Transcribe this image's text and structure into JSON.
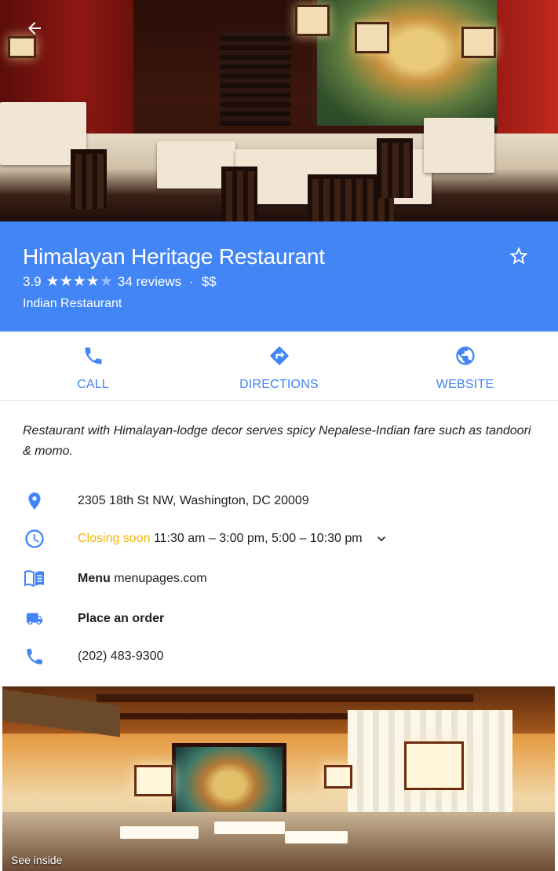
{
  "place": {
    "name": "Himalayan Heritage Restaurant",
    "rating": "3.9",
    "stars_filled": 4,
    "stars_total": 5,
    "reviews_text": "34 reviews",
    "separator": "·",
    "price": "$$",
    "category": "Indian Restaurant"
  },
  "actions": [
    {
      "label": "CALL",
      "icon": "phone-icon"
    },
    {
      "label": "DIRECTIONS",
      "icon": "directions-icon"
    },
    {
      "label": "WEBSITE",
      "icon": "globe-icon"
    }
  ],
  "description": "Restaurant with Himalayan-lodge decor serves spicy Nepalese-Indian fare such as tandoori & momo.",
  "info": {
    "address": "2305 18th St NW, Washington, DC 20009",
    "hours_status": "Closing soon",
    "hours_text": "11:30 am – 3:00 pm, 5:00 – 10:30 pm",
    "menu_label": "Menu",
    "menu_site": "menupages.com",
    "order_label": "Place an order",
    "phone": "(202) 483-9300"
  },
  "photo_caption": "See inside",
  "colors": {
    "accent": "#4285f4",
    "closing": "#f4b400"
  }
}
